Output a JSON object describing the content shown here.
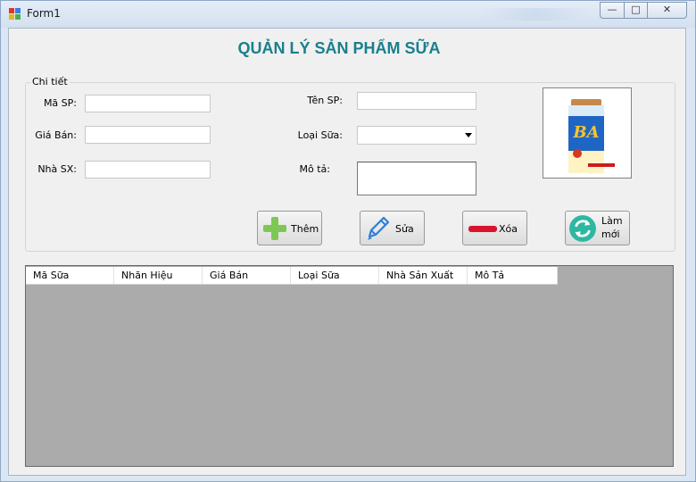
{
  "window": {
    "title": "Form1",
    "controls": {
      "minimize": "—",
      "maximize": "□",
      "close": "✕"
    }
  },
  "heading": "QUẢN LÝ SẢN PHẨM SỮA",
  "details_group": {
    "caption": "Chi tiết",
    "fields": {
      "ma_sp": {
        "label": "Mã SP:",
        "value": ""
      },
      "gia_ban": {
        "label": "Giá Bán:",
        "value": ""
      },
      "nha_sx": {
        "label": "Nhà SX:",
        "value": ""
      },
      "ten_sp": {
        "label": "Tên SP:",
        "value": ""
      },
      "loai_sua": {
        "label": "Loại Sữa:",
        "selected": ""
      },
      "mo_ta": {
        "label": "Mô tả:",
        "value": ""
      }
    },
    "product_image": {
      "description": "milk powder can",
      "icon": "milk-can-image"
    }
  },
  "buttons": {
    "them": {
      "label": "Thêm",
      "icon": "plus-icon",
      "color": "#7dc855"
    },
    "sua": {
      "label": "Sửa",
      "icon": "pencil-icon",
      "color": "#2d7fd6"
    },
    "xoa": {
      "label": "Xóa",
      "icon": "minus-icon",
      "color": "#d8142d"
    },
    "lam_moi": {
      "label_line1": "Làm",
      "label_line2": "mới",
      "icon": "refresh-icon",
      "color": "#2eb8a2"
    }
  },
  "grid": {
    "columns": [
      "Mã Sữa",
      "Nhãn Hiệu",
      "Giá Bán",
      "Loại Sữa",
      "Nhà Sản Xuất",
      "Mô Tả"
    ],
    "rows": []
  },
  "colors": {
    "heading": "#1a7f8c",
    "grid_background": "#ababab",
    "form_background": "#f0f0f0"
  }
}
